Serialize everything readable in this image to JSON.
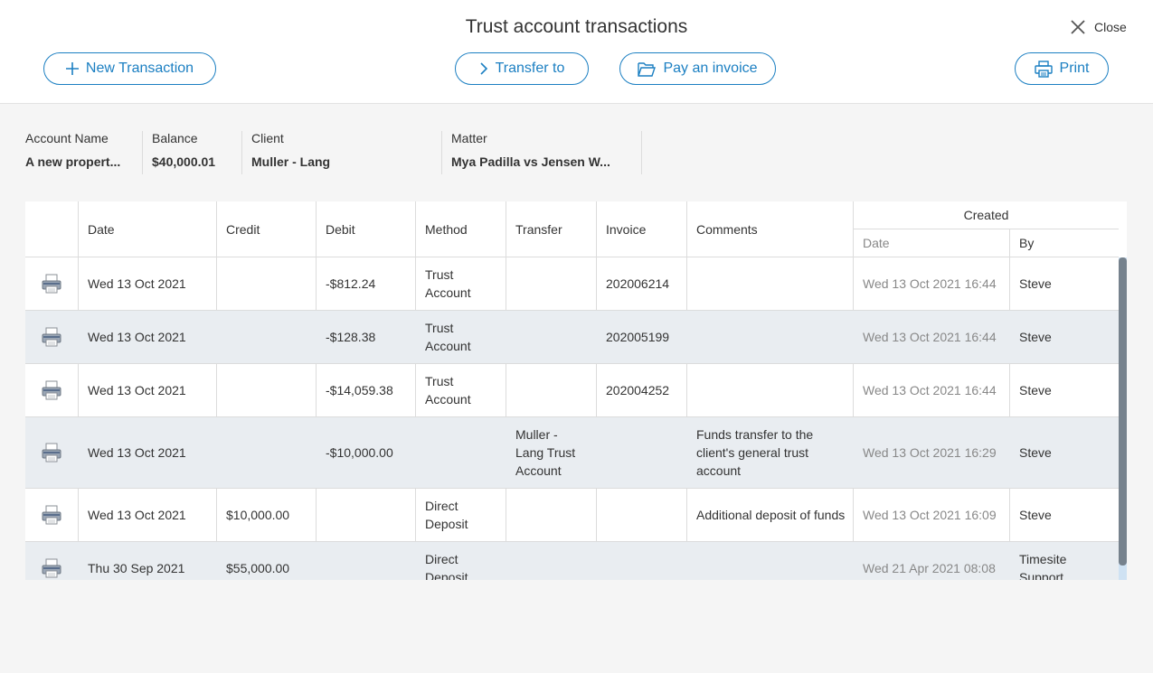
{
  "title": "Trust account transactions",
  "close_label": "Close",
  "toolbar": {
    "new_transaction": "New Transaction",
    "transfer_to": "Transfer to",
    "pay_invoice": "Pay an invoice",
    "print": "Print"
  },
  "info": {
    "account_name": {
      "label": "Account Name",
      "value": "A new propert..."
    },
    "balance": {
      "label": "Balance",
      "value": "$40,000.01"
    },
    "client": {
      "label": "Client",
      "value": "Muller - Lang"
    },
    "matter": {
      "label": "Matter",
      "value": "Mya Padilla vs Jensen W..."
    }
  },
  "table": {
    "headers": {
      "date": "Date",
      "credit": "Credit",
      "debit": "Debit",
      "method": "Method",
      "transfer": "Transfer",
      "invoice": "Invoice",
      "comments": "Comments",
      "created": "Created",
      "created_date": "Date",
      "created_by": "By"
    },
    "rows": [
      {
        "date": "Wed 13 Oct 2021",
        "credit": "",
        "debit": "-$812.24",
        "method": "Trust Account",
        "transfer": "",
        "invoice": "202006214",
        "comments": "",
        "created_date": "Wed 13 Oct 2021 16:44",
        "created_by": "Steve"
      },
      {
        "date": "Wed 13 Oct 2021",
        "credit": "",
        "debit": "-$128.38",
        "method": "Trust Account",
        "transfer": "",
        "invoice": "202005199",
        "comments": "",
        "created_date": "Wed 13 Oct 2021 16:44",
        "created_by": "Steve"
      },
      {
        "date": "Wed 13 Oct 2021",
        "credit": "",
        "debit": "-$14,059.38",
        "method": "Trust Account",
        "transfer": "",
        "invoice": "202004252",
        "comments": "",
        "created_date": "Wed 13 Oct 2021 16:44",
        "created_by": "Steve"
      },
      {
        "date": "Wed 13 Oct 2021",
        "credit": "",
        "debit": "-$10,000.00",
        "method": "",
        "transfer": "Muller - Lang Trust Account",
        "invoice": "",
        "comments": "Funds transfer to the client's general trust account",
        "created_date": "Wed 13 Oct 2021 16:29",
        "created_by": "Steve"
      },
      {
        "date": "Wed 13 Oct 2021",
        "credit": "$10,000.00",
        "debit": "",
        "method": "Direct Deposit",
        "transfer": "",
        "invoice": "",
        "comments": "Additional deposit of funds",
        "created_date": "Wed 13 Oct 2021 16:09",
        "created_by": "Steve"
      },
      {
        "date": "Thu 30 Sep 2021",
        "credit": "$55,000.00",
        "debit": "",
        "method": "Direct Deposit",
        "transfer": "",
        "invoice": "",
        "comments": "",
        "created_date": "Wed 21 Apr 2021 08:08",
        "created_by": "Timesite Support"
      }
    ]
  },
  "colors": {
    "accent": "#1b7fc2",
    "row_alt": "#e9edf1",
    "scroll_thumb": "#76828d"
  }
}
